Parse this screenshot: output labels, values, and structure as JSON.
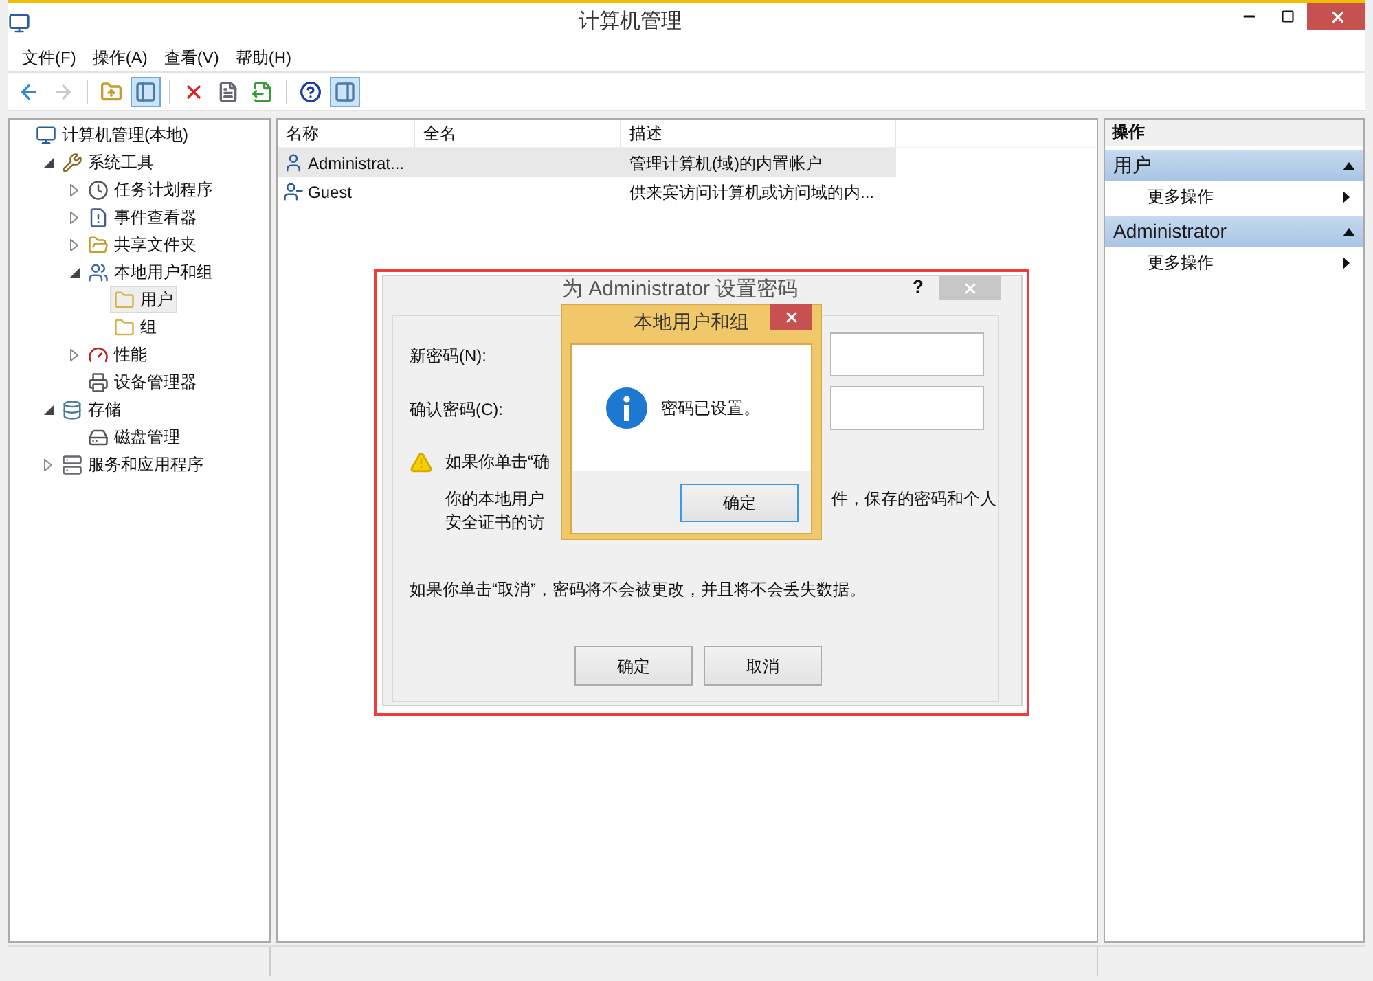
{
  "window": {
    "title": "计算机管理"
  },
  "menu": [
    "文件(F)",
    "操作(A)",
    "查看(V)",
    "帮助(H)"
  ],
  "toolbar": [
    {
      "kind": "back",
      "disabled": false,
      "pressed": false
    },
    {
      "kind": "forward",
      "disabled": true,
      "pressed": false
    },
    {
      "kind": "sep"
    },
    {
      "kind": "up",
      "disabled": false,
      "pressed": false
    },
    {
      "kind": "tree",
      "disabled": false,
      "pressed": true
    },
    {
      "kind": "sep"
    },
    {
      "kind": "delete",
      "disabled": false,
      "pressed": false
    },
    {
      "kind": "properties",
      "disabled": false,
      "pressed": false
    },
    {
      "kind": "export",
      "disabled": false,
      "pressed": false
    },
    {
      "kind": "sep"
    },
    {
      "kind": "help",
      "disabled": false,
      "pressed": false
    },
    {
      "kind": "actions",
      "disabled": false,
      "pressed": true
    }
  ],
  "tree": [
    {
      "label": "计算机管理(本地)",
      "kind": "computer",
      "selected": false,
      "children": [
        {
          "label": "系统工具",
          "kind": "tools",
          "expanded": true,
          "selected": false,
          "children": [
            {
              "label": "任务计划程序",
              "kind": "clock",
              "expanded": false,
              "selected": false
            },
            {
              "label": "事件查看器",
              "kind": "event",
              "expanded": false,
              "selected": false
            },
            {
              "label": "共享文件夹",
              "kind": "share",
              "expanded": false,
              "selected": false
            },
            {
              "label": "本地用户和组",
              "kind": "users",
              "expanded": true,
              "selected": false,
              "children": [
                {
                  "label": "用户",
                  "kind": "folder",
                  "selected": true
                },
                {
                  "label": "组",
                  "kind": "folder",
                  "selected": false
                }
              ]
            },
            {
              "label": "性能",
              "kind": "perf",
              "expanded": false,
              "selected": false
            },
            {
              "label": "设备管理器",
              "kind": "device",
              "selected": false
            }
          ]
        },
        {
          "label": "存储",
          "kind": "storage",
          "expanded": true,
          "selected": false,
          "children": [
            {
              "label": "磁盘管理",
              "kind": "disk",
              "selected": false
            }
          ]
        },
        {
          "label": "服务和应用程序",
          "kind": "services",
          "expanded": false,
          "selected": false
        }
      ]
    }
  ],
  "list": {
    "columns": [
      "名称",
      "全名",
      "描述"
    ],
    "rows": [
      {
        "name": "Administrat...",
        "description": "管理计算机(域)的内置帐户",
        "kind": "admin",
        "selected": true
      },
      {
        "name": "Guest",
        "description": "供来宾访问计算机或访问域的内...",
        "kind": "guest",
        "selected": false
      }
    ]
  },
  "actions": {
    "header": "操作",
    "sections": [
      {
        "title": "用户",
        "items": [
          "更多操作"
        ]
      },
      {
        "title": "Administrator",
        "items": [
          "更多操作"
        ]
      }
    ]
  },
  "password_dialog": {
    "title": "为 Administrator 设置密码",
    "help": "?",
    "highlighted": true,
    "fields": [
      {
        "label": "新密码(N):"
      },
      {
        "label": "确认密码(C):"
      }
    ],
    "warning_lines": [
      {
        "left": "如果你单击“确"
      },
      {
        "left": "你的本地用户",
        "right": "件，保存的密码和个人"
      },
      {
        "left": "安全证书的访"
      }
    ],
    "cancel_note": "如果你单击“取消”，密码将不会被更改，并且将不会丢失数据。",
    "buttons": [
      "确定",
      "取消"
    ]
  },
  "message_box": {
    "title": "本地用户和组",
    "message": "密码已设置。",
    "button": "确定"
  }
}
